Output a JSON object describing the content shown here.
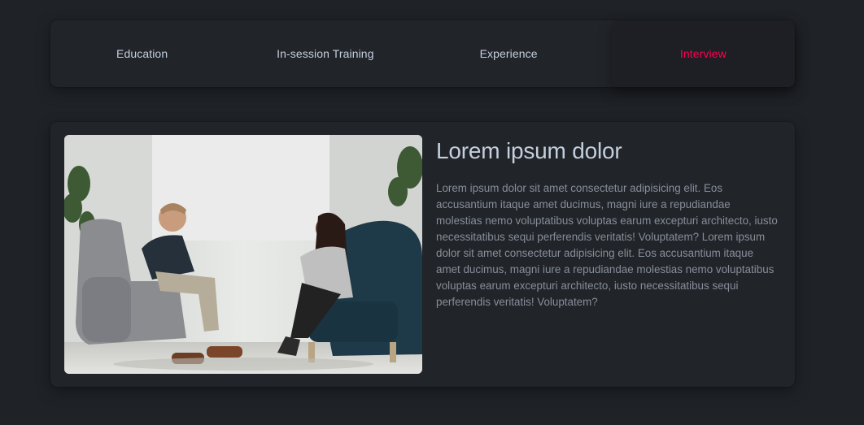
{
  "tabs": {
    "items": [
      {
        "label": "Education"
      },
      {
        "label": "In-session Training"
      },
      {
        "label": "Experience"
      },
      {
        "label": "Interview"
      }
    ],
    "active_index": 3
  },
  "content": {
    "title": "Lorem ipsum dolor",
    "description": "Lorem ipsum dolor sit amet consectetur adipisicing elit. Eos accusantium itaque amet ducimus, magni iure a repudiandae molestias nemo voluptatibus voluptas earum excepturi architecto, iusto necessitatibus sequi perferendis veritatis! Voluptatem? Lorem ipsum dolor sit amet consectetur adipisicing elit. Eos accusantium itaque amet ducimus, magni iure a repudiandae molestias nemo voluptatibus voluptas earum excepturi architecto, iusto necessitatibus sequi perferendis veritatis! Voluptatem?"
  },
  "colors": {
    "background": "#1f2227",
    "card": "#212429",
    "accent": "#ff014f",
    "text_primary": "#c4cfde",
    "text_body": "#878e99"
  }
}
